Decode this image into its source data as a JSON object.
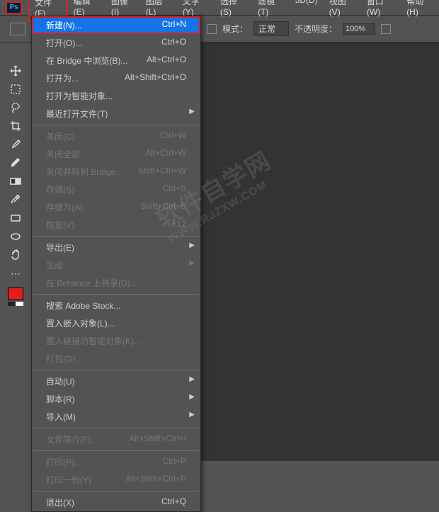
{
  "menubar": {
    "items": [
      "文件(F)",
      "编辑(E)",
      "图像(I)",
      "图层(L)",
      "文字(Y)",
      "选择(S)",
      "滤镜(T)",
      "3D(D)",
      "视图(V)",
      "窗口(W)",
      "帮助(H)"
    ]
  },
  "toolbar": {
    "mode_label": "模式：",
    "mode_value": "正常",
    "opacity_label": "不透明度：",
    "opacity_value": "100%"
  },
  "dropdown": {
    "items": [
      {
        "label": "新建(N)...",
        "shortcut": "Ctrl+N",
        "highlight": true
      },
      {
        "label": "打开(O)...",
        "shortcut": "Ctrl+O"
      },
      {
        "label": "在 Bridge 中浏览(B)...",
        "shortcut": "Alt+Ctrl+O"
      },
      {
        "label": "打开为...",
        "shortcut": "Alt+Shift+Ctrl+O"
      },
      {
        "label": "打开为智能对象..."
      },
      {
        "label": "最近打开文件(T)",
        "submenu": true
      },
      {
        "sep": true
      },
      {
        "label": "关闭(C)",
        "shortcut": "Ctrl+W",
        "disabled": true
      },
      {
        "label": "关闭全部",
        "shortcut": "Alt+Ctrl+W",
        "disabled": true
      },
      {
        "label": "关闭并转到 Bridge...",
        "shortcut": "Shift+Ctrl+W",
        "disabled": true
      },
      {
        "label": "存储(S)",
        "shortcut": "Ctrl+S",
        "disabled": true
      },
      {
        "label": "存储为(A)...",
        "shortcut": "Shift+Ctrl+S",
        "disabled": true
      },
      {
        "label": "恢复(V)",
        "shortcut": "F12",
        "disabled": true
      },
      {
        "sep": true
      },
      {
        "label": "导出(E)",
        "submenu": true
      },
      {
        "label": "生成",
        "submenu": true,
        "disabled": true
      },
      {
        "label": "在 Behance 上共享(D)...",
        "disabled": true
      },
      {
        "sep": true
      },
      {
        "label": "搜索 Adobe Stock..."
      },
      {
        "label": "置入嵌入对象(L)..."
      },
      {
        "label": "置入链接的智能对象(K)...",
        "disabled": true
      },
      {
        "label": "打包(G)...",
        "disabled": true
      },
      {
        "sep": true
      },
      {
        "label": "自动(U)",
        "submenu": true
      },
      {
        "label": "脚本(R)",
        "submenu": true
      },
      {
        "label": "导入(M)",
        "submenu": true
      },
      {
        "sep": true
      },
      {
        "label": "文件简介(F)...",
        "shortcut": "Alt+Shift+Ctrl+I",
        "disabled": true
      },
      {
        "sep": true
      },
      {
        "label": "打印(P)...",
        "shortcut": "Ctrl+P",
        "disabled": true
      },
      {
        "label": "打印一份(Y)",
        "shortcut": "Alt+Shift+Ctrl+P",
        "disabled": true
      },
      {
        "sep": true
      },
      {
        "label": "退出(X)",
        "shortcut": "Ctrl+Q"
      }
    ]
  },
  "watermark": {
    "line1": "软件自学网",
    "line2": "WWW.RJZXW.COM"
  },
  "ps_logo": "Ps"
}
